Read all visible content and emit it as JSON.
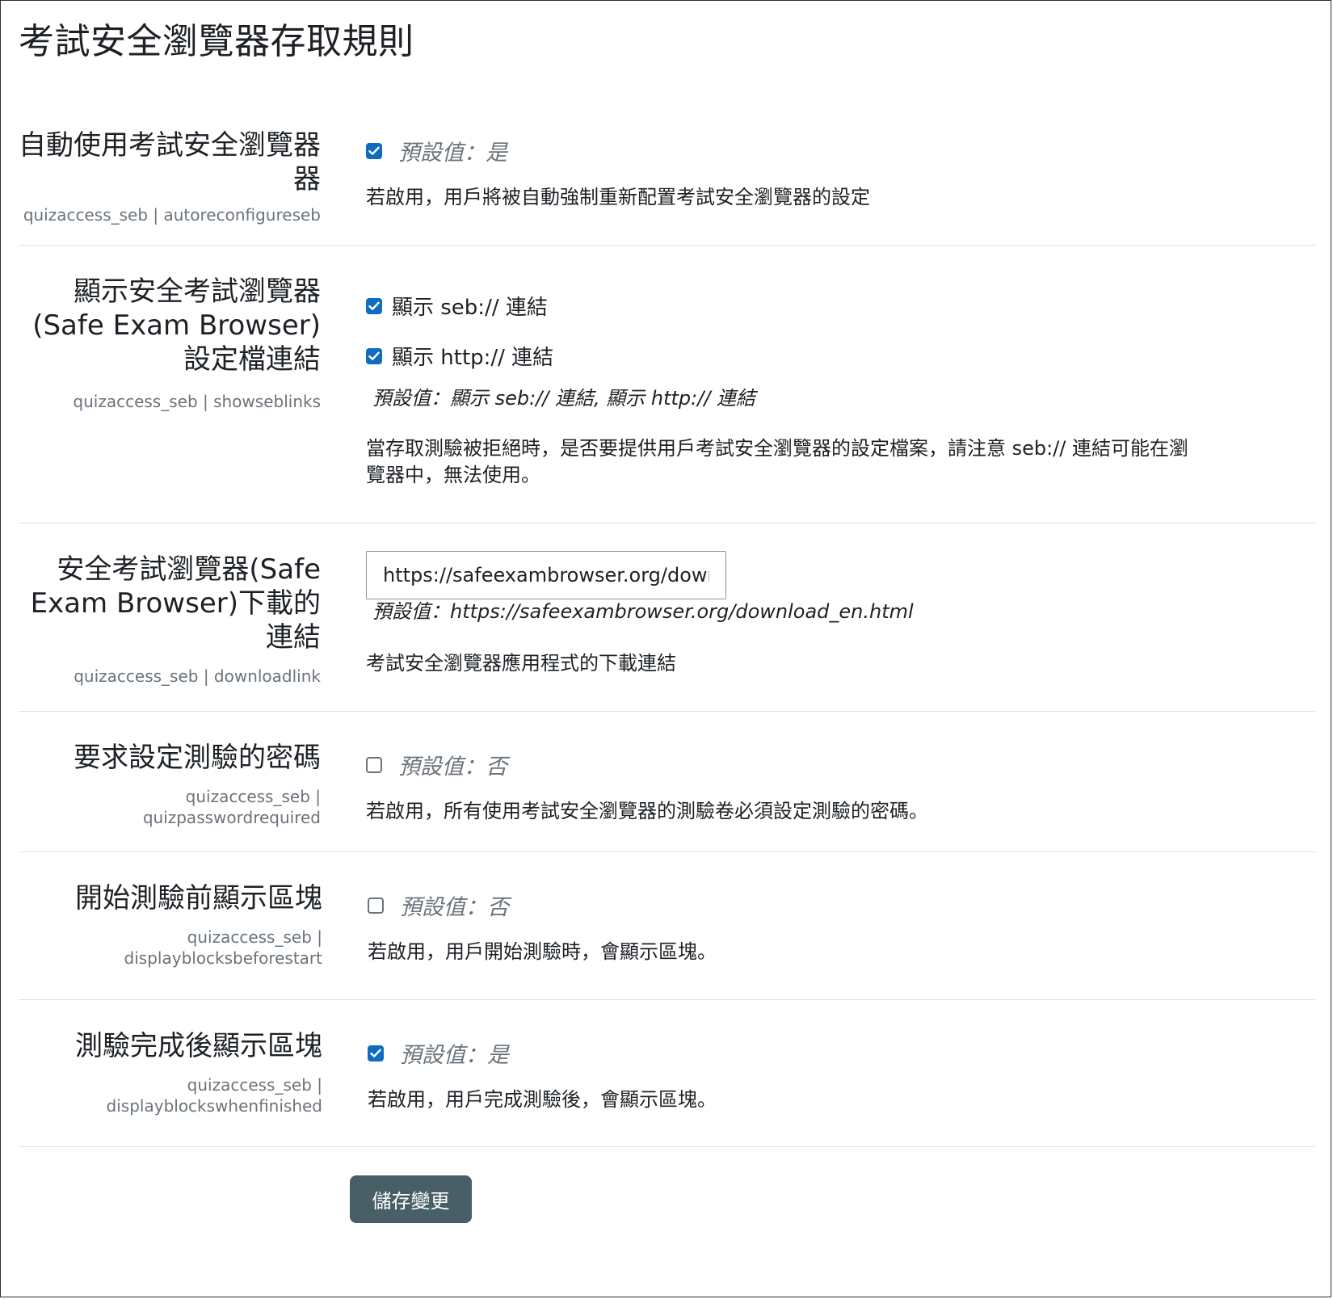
{
  "page": {
    "title": "考試安全瀏覽器存取規則"
  },
  "settings": {
    "autoreconfigure": {
      "label": "自動使用考試安全瀏覽器",
      "label2": "器",
      "key": "quizaccess_seb | autoreconfigureseb",
      "default": "預設值：是",
      "description": "若啟用，用戶將被自動強制重新配置考試安全瀏覽器的設定",
      "checked": true
    },
    "showseblinks": {
      "label": "顯示安全考試瀏覽器",
      "label2": "(Safe Exam Browser)",
      "label3": "設定檔連結",
      "key": "quizaccess_seb | showseblinks",
      "options": [
        {
          "label": "顯示 seb:// 連結",
          "checked": true
        },
        {
          "label": "顯示 http:// 連結",
          "checked": true
        }
      ],
      "default": "預設值：顯示 seb:// 連結, 顯示 http:// 連結",
      "description_line1": "當存取測驗被拒絕時，是否要提供用戶考試安全瀏覽器的設定檔案，請注意 seb:// 連結可能在瀏",
      "description_line2": "覽器中，無法使用。"
    },
    "downloadlink": {
      "label": "安全考試瀏覽器(Safe",
      "label2": "Exam Browser)下載的",
      "label3": "連結",
      "key": "quizaccess_seb | downloadlink",
      "value": "https://safeexambrowser.org/download_en.html",
      "default": "預設值：https://safeexambrowser.org/download_en.html",
      "description": "考試安全瀏覽器應用程式的下載連結"
    },
    "quizpasswordrequired": {
      "label": "要求設定測驗的密碼",
      "key": "quizaccess_seb |",
      "key2": "quizpasswordrequired",
      "default": "預設值：否",
      "description": "若啟用，所有使用考試安全瀏覽器的測驗卷必須設定測驗的密碼。",
      "checked": false
    },
    "displayblocksbeforestart": {
      "label": "開始測驗前顯示區塊",
      "key": "quizaccess_seb |",
      "key2": "displayblocksbeforestart",
      "default": "預設值：否",
      "description": "若啟用，用戶開始測驗時，會顯示區塊。",
      "checked": false
    },
    "displayblockswhenfinished": {
      "label": "測驗完成後顯示區塊",
      "key": "quizaccess_seb |",
      "key2": "displayblockswhenfinished",
      "default": "預設值：是",
      "description": "若啟用，用戶完成測驗後，會顯示區塊。",
      "checked": true
    }
  },
  "footer": {
    "save_label": "儲存變更"
  },
  "colors": {
    "checkbox_checked": "#0f6cbf",
    "button_bg": "#495f67",
    "muted_text": "#6a737b",
    "divider": "#dee2e6"
  }
}
